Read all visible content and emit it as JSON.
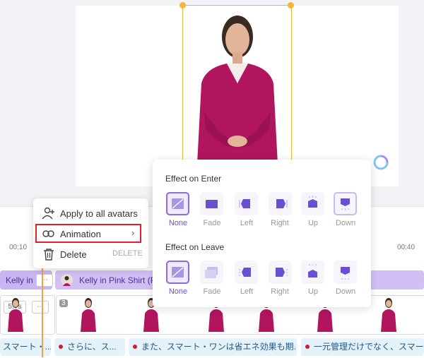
{
  "context_menu": {
    "apply_all": "Apply to all avatars",
    "animation": "Animation",
    "delete": "Delete",
    "delete_shortcut": "DELETE"
  },
  "effects": {
    "enter_title": "Effect on Enter",
    "leave_title": "Effect on Leave",
    "options": [
      "None",
      "Fade",
      "Left",
      "Right",
      "Up",
      "Down"
    ],
    "enter_selected": "None",
    "leave_selected": "None"
  },
  "timeline": {
    "ruler": [
      "00:10",
      "00:40"
    ],
    "clip_a": "Kelly in",
    "clip_b": "Kelly in Pink Shirt (Fr",
    "duration_badge": "5.7s",
    "scene_badge": "3",
    "subtitles": [
      "スマート・...",
      "さらに、ス...",
      "また、スマート・ワンは省エネ効果も期...",
      "一元管理だけでなく、スマート"
    ]
  },
  "colors": {
    "accent": "#8a6be0",
    "avatar_shirt": "#b0155e",
    "highlight": "#e0202a",
    "playhead": "#f2a23a"
  }
}
